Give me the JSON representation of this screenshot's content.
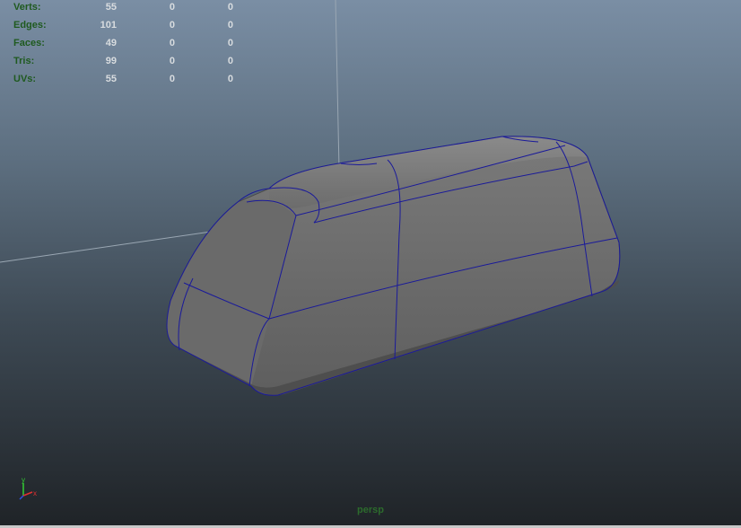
{
  "hud": {
    "rows": [
      {
        "label": "Verts:",
        "values": [
          "55",
          "0",
          "0"
        ]
      },
      {
        "label": "Edges:",
        "values": [
          "101",
          "0",
          "0"
        ]
      },
      {
        "label": "Faces:",
        "values": [
          "49",
          "0",
          "0"
        ]
      },
      {
        "label": "Tris:",
        "values": [
          "99",
          "0",
          "0"
        ]
      },
      {
        "label": "UVs:",
        "values": [
          "55",
          "0",
          "0"
        ]
      }
    ]
  },
  "camera_label": "persp",
  "axis": {
    "y_label": "y",
    "x_label": "x"
  },
  "colors": {
    "hud_label": "#1f5a1f",
    "hud_value": "#d8dcdf",
    "wireframe": "#1a1a9a",
    "camera_label": "#2c6b2c"
  }
}
